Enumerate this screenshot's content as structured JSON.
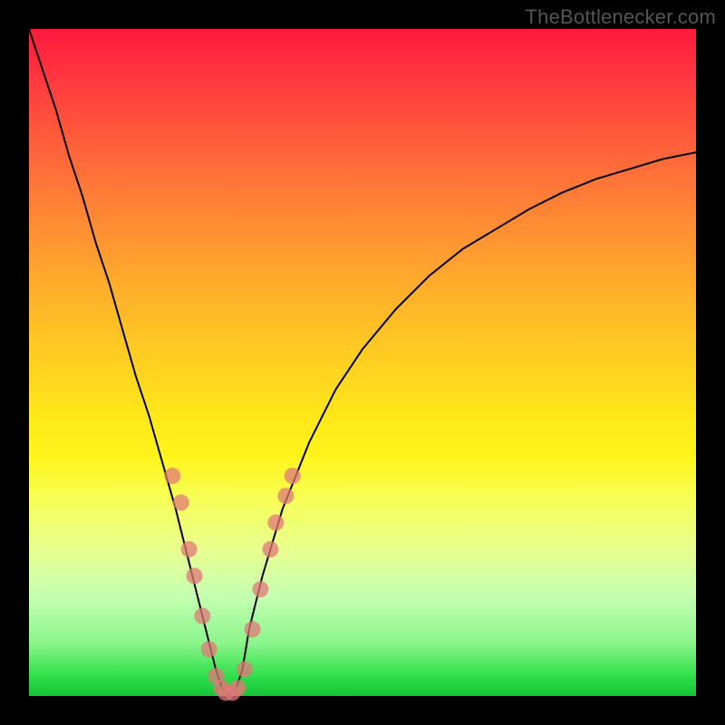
{
  "watermark": "TheBottlenecker.com",
  "chart_data": {
    "type": "line",
    "title": "",
    "xlabel": "",
    "ylabel": "",
    "xlim": [
      0,
      100
    ],
    "ylim": [
      0,
      100
    ],
    "grid": false,
    "legend": false,
    "gradient": {
      "top_color": "#ff1a3d",
      "bottom_color": "#15c438",
      "note": "background is a vertical red→orange→yellow→green gradient; curve value near 0 (bottom) means green/no-bottleneck, near 100 (top) means red/severe-bottleneck"
    },
    "series": [
      {
        "name": "bottleneck-curve",
        "stroke": "#000000",
        "stroke_width": 2,
        "x": [
          0,
          2,
          4,
          6,
          8,
          10,
          12,
          14,
          16,
          18,
          20,
          22,
          24,
          26,
          27,
          28,
          29,
          30,
          31,
          32,
          33,
          35,
          38,
          42,
          46,
          50,
          55,
          60,
          65,
          70,
          75,
          80,
          85,
          90,
          95,
          100
        ],
        "y": [
          100,
          94,
          88,
          81,
          75,
          68,
          62,
          55,
          48,
          42,
          35,
          28,
          20,
          12,
          8,
          4,
          1,
          0,
          1,
          4,
          10,
          18,
          28,
          38,
          46,
          52,
          58,
          63,
          67,
          70,
          73,
          75.5,
          77.5,
          79,
          80.5,
          81.5
        ]
      }
    ],
    "markers": {
      "name": "sample-points",
      "fill": "#e07878",
      "fill_opacity": 0.75,
      "radius_px": 9,
      "points": [
        {
          "x": 21.5,
          "y": 33
        },
        {
          "x": 22.8,
          "y": 29
        },
        {
          "x": 24.0,
          "y": 22
        },
        {
          "x": 24.8,
          "y": 18
        },
        {
          "x": 26.0,
          "y": 12
        },
        {
          "x": 27.0,
          "y": 7
        },
        {
          "x": 28.0,
          "y": 3
        },
        {
          "x": 28.8,
          "y": 1.2
        },
        {
          "x": 29.5,
          "y": 0.5
        },
        {
          "x": 30.5,
          "y": 0.5
        },
        {
          "x": 31.3,
          "y": 1.2
        },
        {
          "x": 32.3,
          "y": 4
        },
        {
          "x": 33.5,
          "y": 10
        },
        {
          "x": 34.7,
          "y": 16
        },
        {
          "x": 36.2,
          "y": 22
        },
        {
          "x": 37.0,
          "y": 26
        },
        {
          "x": 38.5,
          "y": 30
        },
        {
          "x": 39.5,
          "y": 33
        }
      ]
    }
  }
}
